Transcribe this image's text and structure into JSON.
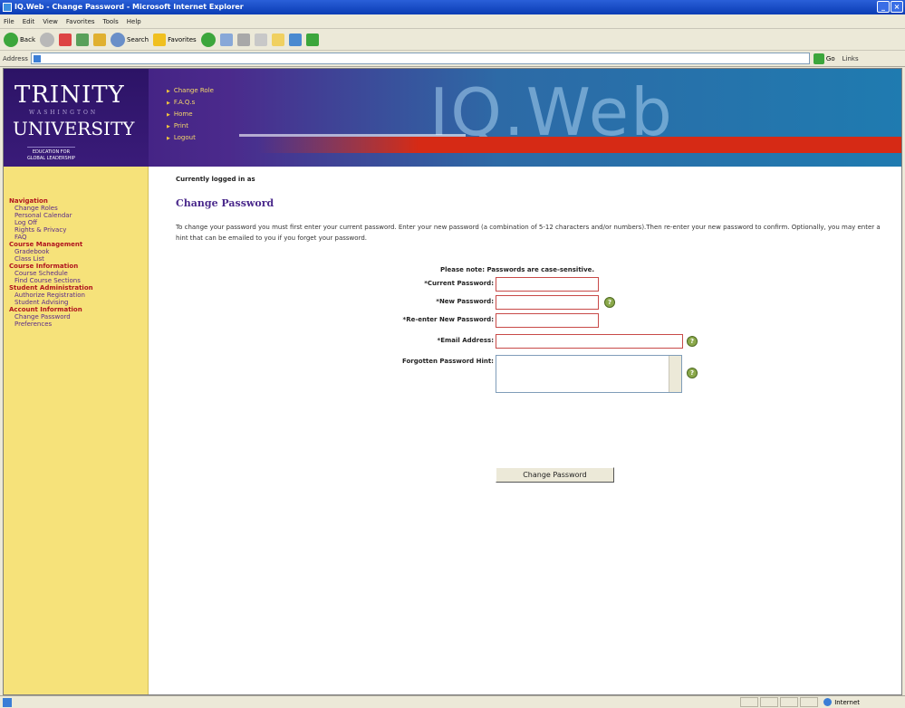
{
  "window": {
    "title": "IQ.Web - Change Password - Microsoft Internet Explorer",
    "buttons": [
      "_",
      "×"
    ]
  },
  "menu": [
    "File",
    "Edit",
    "View",
    "Favorites",
    "Tools",
    "Help"
  ],
  "toolbar": {
    "back": "Back",
    "search": "Search",
    "favorites": "Favorites"
  },
  "addressbar": {
    "label": "Address",
    "go": "Go",
    "links": "Links"
  },
  "banner": {
    "logo_top": "TRINITY",
    "logo_mid": "WASHINGTON",
    "logo_bottom": "UNIVERSITY",
    "logo_tag1": "EDUCATION FOR",
    "logo_tag2": "GLOBAL LEADERSHIP",
    "brand": "IQ.Web",
    "nav": [
      "Change Role",
      "F.A.Q.s",
      "Home",
      "Print",
      "Logout"
    ]
  },
  "sidebar": {
    "sections": [
      {
        "title": "Navigation",
        "items": [
          "Change Roles",
          "Personal Calendar",
          "Log Off",
          "Rights & Privacy",
          "FAQ"
        ]
      },
      {
        "title": "Course Management",
        "items": [
          "Gradebook",
          "Class List"
        ]
      },
      {
        "title": "Course Information",
        "items": [
          "Course Schedule",
          "Find Course Sections"
        ]
      },
      {
        "title": "Student Administration",
        "items": [
          "Authorize Registration",
          "Student Advising"
        ]
      },
      {
        "title": "Account Information",
        "items": [
          "Change Password",
          "Preferences"
        ]
      }
    ]
  },
  "main": {
    "logged_in": "Currently logged in as",
    "heading": "Change Password",
    "instructions": "To change your password you must first enter your current password. Enter your new password (a combination of 5-12 characters and/or numbers).Then re-enter your new password to confirm. Optionally, you may enter a hint that can be emailed to you if you forget your password.",
    "note": "Please note: Passwords are case-sensitive.",
    "fields": {
      "current": "*Current Password:",
      "new": "*New Password:",
      "reenter": "*Re-enter New Password:",
      "email": "*Email Address:",
      "hint": "Forgotten Password Hint:"
    },
    "submit": "Change Password"
  },
  "status": {
    "zone": "Internet"
  },
  "colors": {
    "sidebar_bg": "#f6e27a",
    "section_red": "#b0141e",
    "link_purple": "#5a2a8a",
    "banner_purple": "#3d1d7d",
    "banner_red": "#d62a15"
  }
}
